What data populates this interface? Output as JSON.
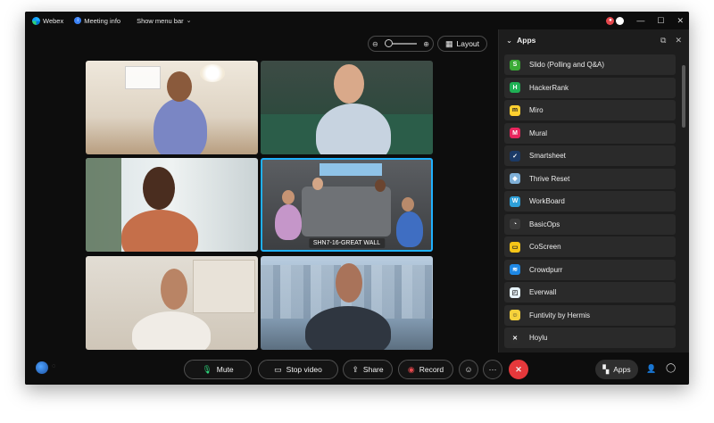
{
  "titlebar": {
    "app_name": "Webex",
    "meeting_info": "Meeting info",
    "show_menu_bar": "Show menu bar",
    "minimize": "—",
    "maximize": "☐",
    "close": "✕"
  },
  "stage": {
    "layout_label": "Layout",
    "zoom_out": "⊖",
    "zoom_in": "⊕",
    "tile_label": "SHN7-16-GREAT WALL"
  },
  "apps_panel": {
    "title": "Apps",
    "items": [
      {
        "name": "Slido (Polling and Q&A)",
        "glyph": "S",
        "color": "#3aaa35"
      },
      {
        "name": "HackerRank",
        "glyph": "H",
        "color": "#1fb155"
      },
      {
        "name": "Miro",
        "glyph": "m",
        "color": "#ffd02f"
      },
      {
        "name": "Mural",
        "glyph": "M",
        "color": "#e8265e"
      },
      {
        "name": "Smartsheet",
        "glyph": "✓",
        "color": "#1b3a66"
      },
      {
        "name": "Thrive Reset",
        "glyph": "◆",
        "color": "#7fb0d8"
      },
      {
        "name": "WorkBoard",
        "glyph": "W",
        "color": "#2d9fd8"
      },
      {
        "name": "BasicOps",
        "glyph": "◔",
        "color": "#3b3b3b"
      },
      {
        "name": "CoScreen",
        "glyph": "▭",
        "color": "#f5c518"
      },
      {
        "name": "Crowdpurr",
        "glyph": "≋",
        "color": "#1e88e5"
      },
      {
        "name": "Everwall",
        "glyph": "◰",
        "color": "#e6f3fa"
      },
      {
        "name": "Funtivity by Hermis",
        "glyph": "☺",
        "color": "#f7d23b"
      },
      {
        "name": "Hoylu",
        "glyph": "✕",
        "color": "#2b2b2b"
      }
    ]
  },
  "controls": {
    "mute": "Mute",
    "stop_video": "Stop video",
    "share": "Share",
    "record": "Record",
    "more": "···",
    "end_call": "✕",
    "apps": "Apps"
  },
  "colors": {
    "accent_blue": "#1fb1ff",
    "end_call_red": "#e5383b",
    "record_red": "#e5484d",
    "mic_green": "#2dd27a"
  }
}
